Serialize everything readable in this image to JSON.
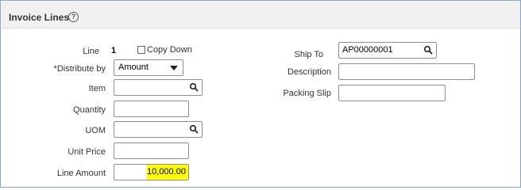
{
  "section": {
    "title": "Invoice Lines",
    "help_glyph": "?"
  },
  "left": {
    "line_label": "Line",
    "line_value": "1",
    "copy_down_label": "Copy Down",
    "copy_down_checked": false,
    "distribute_by_label": "*Distribute by",
    "distribute_by_value": "Amount",
    "item_label": "Item",
    "item_value": "",
    "quantity_label": "Quantity",
    "quantity_value": "",
    "uom_label": "UOM",
    "uom_value": "",
    "unit_price_label": "Unit Price",
    "unit_price_value": "",
    "line_amount_label": "Line Amount",
    "line_amount_value": "10,000.00"
  },
  "right": {
    "ship_to_label": "Ship To",
    "ship_to_value": "AP00000001",
    "description_label": "Description",
    "description_value": "",
    "packing_slip_label": "Packing Slip",
    "packing_slip_value": ""
  },
  "colors": {
    "highlight": "#ffff00",
    "frame_border": "#8aa3c8",
    "header_bg": "#f1f1f1"
  },
  "icons": [
    "help-icon",
    "search-icon",
    "chevron-down-icon"
  ]
}
